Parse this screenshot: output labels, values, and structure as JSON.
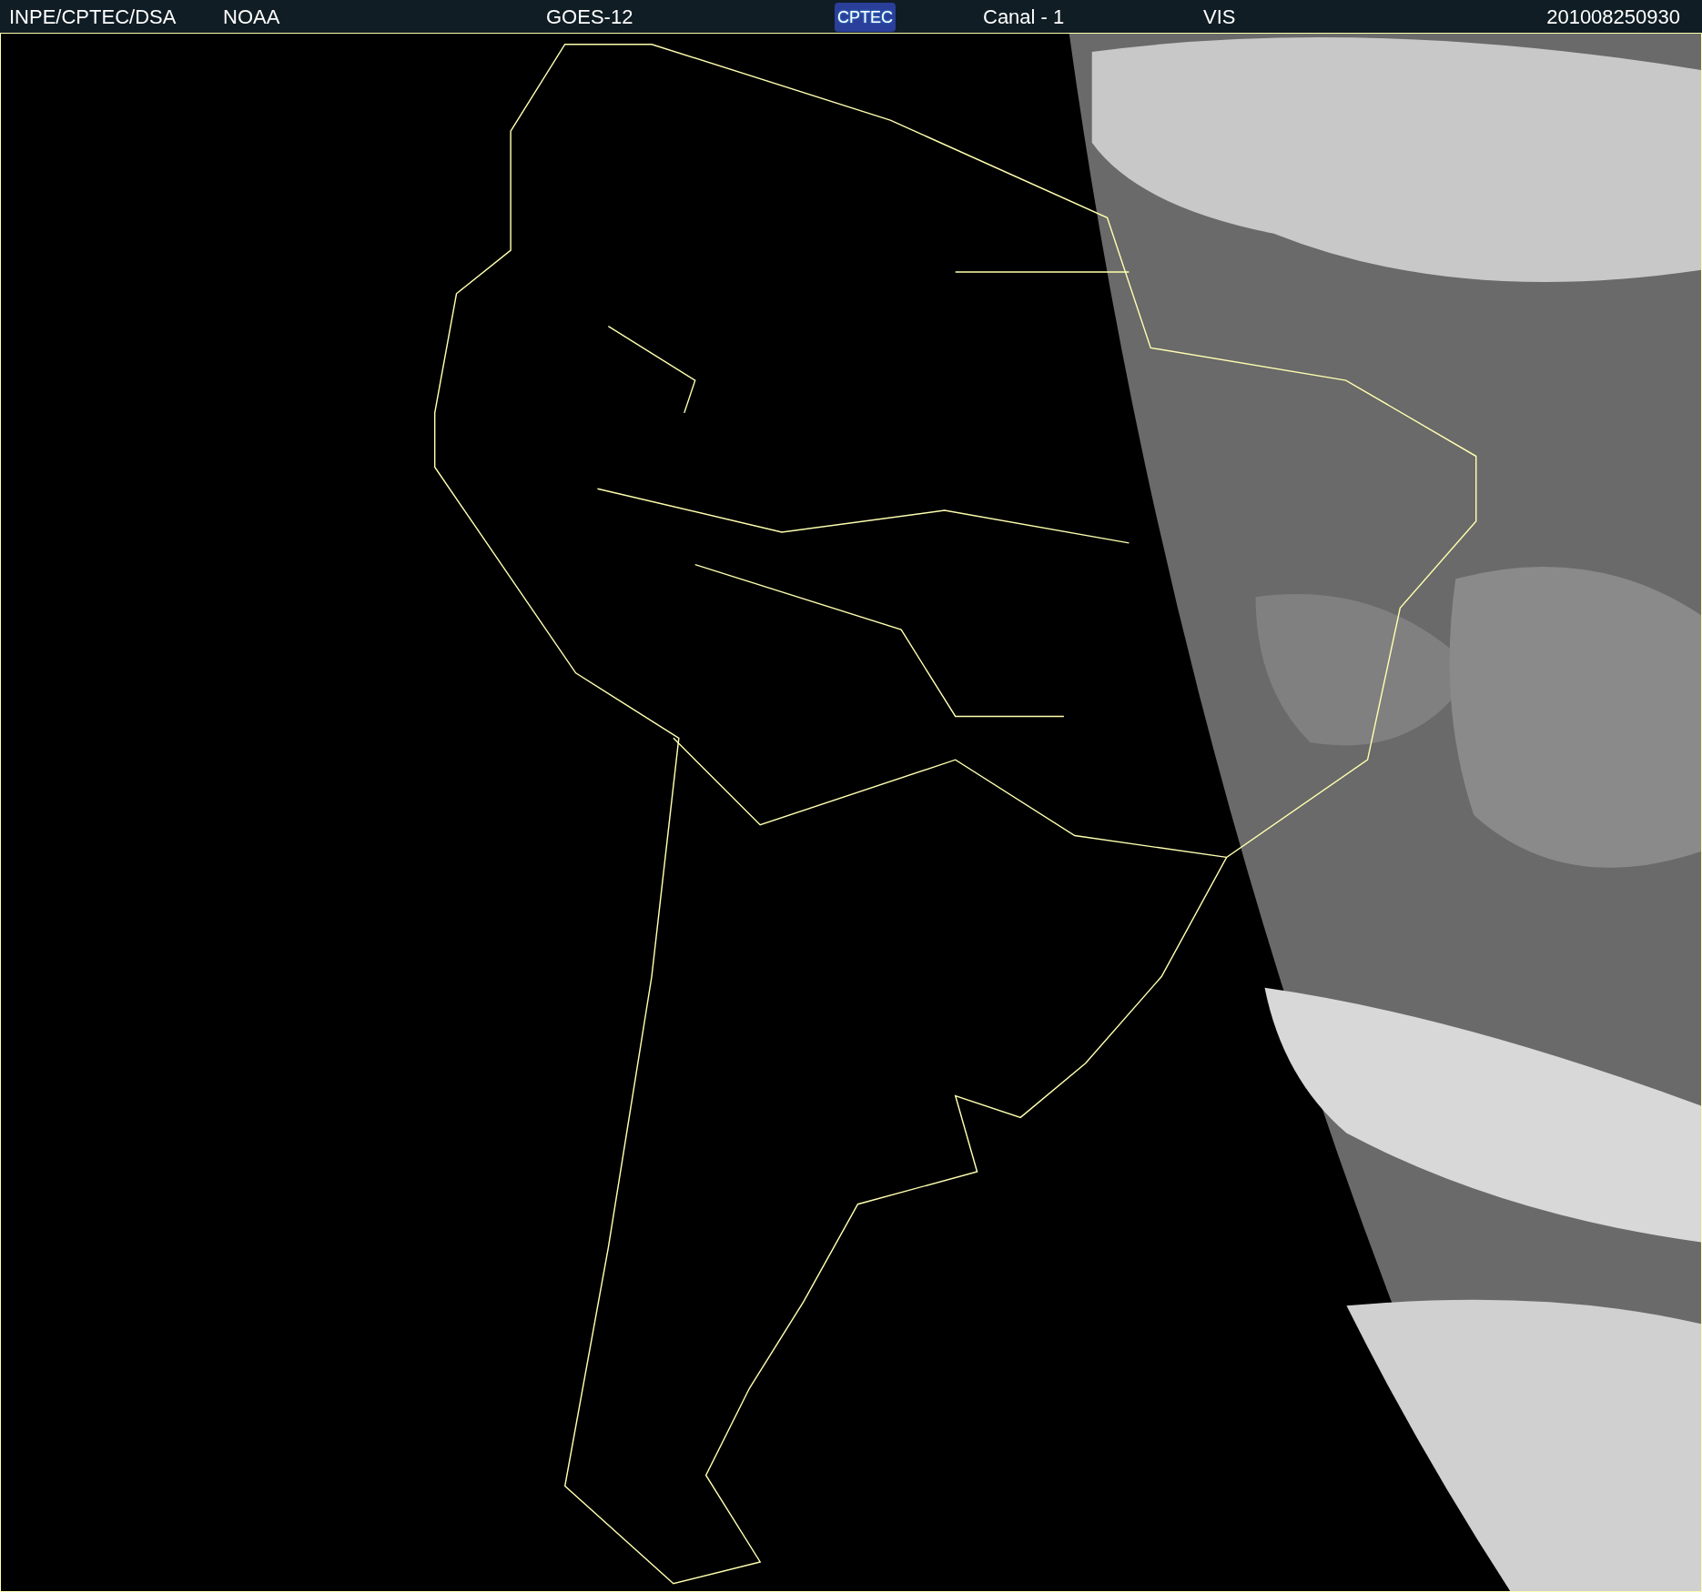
{
  "header": {
    "items": [
      {
        "kind": "text",
        "text": "INPE/CPTEC/DSA"
      },
      {
        "kind": "text",
        "text": "NOAA"
      },
      {
        "kind": "text",
        "text": "GOES-12"
      },
      {
        "kind": "logo",
        "text": "CPTEC"
      },
      {
        "kind": "text",
        "text": "Canal - 1"
      },
      {
        "kind": "text",
        "text": "VIS"
      },
      {
        "kind": "text",
        "text": "201008250930"
      }
    ]
  }
}
